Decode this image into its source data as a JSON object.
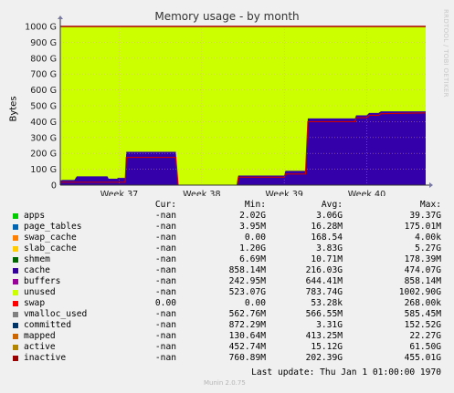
{
  "chart_data": {
    "type": "area",
    "title": "Memory usage - by month",
    "ylabel": "Bytes",
    "ylim": [
      0,
      1000
    ],
    "yticks": [
      "0",
      "100 G",
      "200 G",
      "300 G",
      "400 G",
      "500 G",
      "600 G",
      "700 G",
      "800 G",
      "900 G",
      "1000 G"
    ],
    "xticks": [
      {
        "label": "Week 37",
        "day": 5
      },
      {
        "label": "Week 38",
        "day": 12
      },
      {
        "label": "Week 39",
        "day": 19
      },
      {
        "label": "Week 40",
        "day": 26
      }
    ],
    "x_days": [
      0,
      31
    ],
    "grid": true,
    "series": [
      {
        "name": "cache",
        "color": "#3300aa",
        "points": [
          [
            0,
            30
          ],
          [
            0.1,
            30
          ],
          [
            0.2,
            32
          ],
          [
            1.2,
            32
          ],
          [
            1.4,
            55
          ],
          [
            4.0,
            55
          ],
          [
            4.1,
            40
          ],
          [
            4.8,
            40
          ],
          [
            4.9,
            45
          ],
          [
            5.5,
            45
          ],
          [
            5.6,
            210
          ],
          [
            9.8,
            210
          ],
          [
            10.0,
            0
          ],
          [
            15.0,
            0
          ],
          [
            15.1,
            60
          ],
          [
            18.0,
            60
          ],
          [
            18.1,
            60
          ],
          [
            19.0,
            60
          ],
          [
            19.1,
            90
          ],
          [
            20.8,
            90
          ],
          [
            21.0,
            420
          ],
          [
            25.0,
            420
          ],
          [
            25.1,
            440
          ],
          [
            26.0,
            440
          ],
          [
            26.2,
            455
          ],
          [
            27.0,
            455
          ],
          [
            27.2,
            465
          ],
          [
            31,
            465
          ]
        ]
      },
      {
        "name": "apps",
        "color": "#00cc00",
        "points": [
          [
            0,
            5
          ],
          [
            4,
            5
          ],
          [
            5.5,
            5
          ],
          [
            10,
            0
          ],
          [
            15,
            0
          ],
          [
            15.1,
            4
          ],
          [
            19,
            4
          ],
          [
            21,
            6
          ],
          [
            31,
            6
          ]
        ]
      },
      {
        "name": "unused",
        "color": "#ccff00",
        "points": [
          [
            0,
            1000
          ],
          [
            31,
            1000
          ]
        ]
      }
    ],
    "inactive_line": [
      [
        0,
        18
      ],
      [
        5.5,
        18
      ],
      [
        5.6,
        175
      ],
      [
        9.8,
        175
      ],
      [
        10.0,
        0
      ],
      [
        15.0,
        0
      ],
      [
        15.1,
        50
      ],
      [
        19.0,
        50
      ],
      [
        19.1,
        70
      ],
      [
        20.8,
        70
      ],
      [
        21.0,
        400
      ],
      [
        25.0,
        400
      ],
      [
        25.1,
        425
      ],
      [
        26.0,
        425
      ],
      [
        26.2,
        440
      ],
      [
        27.0,
        440
      ],
      [
        27.2,
        450
      ],
      [
        31,
        455
      ]
    ],
    "swap_line": [
      [
        0,
        1000
      ],
      [
        20.9,
        1000
      ],
      [
        21.0,
        1002
      ],
      [
        31,
        1002
      ]
    ]
  },
  "legend": {
    "headers": {
      "cur": "Cur:",
      "min": "Min:",
      "avg": "Avg:",
      "max": "Max:"
    },
    "rows": [
      {
        "name": "apps",
        "color": "#00cc00",
        "cur": "-nan",
        "min": "2.02G",
        "avg": "3.06G",
        "max": "39.37G"
      },
      {
        "name": "page_tables",
        "color": "#0066b3",
        "cur": "-nan",
        "min": "3.95M",
        "avg": "16.28M",
        "max": "175.01M"
      },
      {
        "name": "swap_cache",
        "color": "#ff8000",
        "cur": "-nan",
        "min": "0.00",
        "avg": "168.54",
        "max": "4.00k"
      },
      {
        "name": "slab_cache",
        "color": "#ffcc00",
        "cur": "-nan",
        "min": "1.20G",
        "avg": "3.83G",
        "max": "5.27G"
      },
      {
        "name": "shmem",
        "color": "#006600",
        "cur": "-nan",
        "min": "6.69M",
        "avg": "10.71M",
        "max": "178.39M"
      },
      {
        "name": "cache",
        "color": "#330099",
        "cur": "-nan",
        "min": "858.14M",
        "avg": "216.03G",
        "max": "474.07G"
      },
      {
        "name": "buffers",
        "color": "#990099",
        "cur": "-nan",
        "min": "242.95M",
        "avg": "644.41M",
        "max": "858.14M"
      },
      {
        "name": "unused",
        "color": "#ccff00",
        "cur": "-nan",
        "min": "523.07G",
        "avg": "783.74G",
        "max": "1002.90G"
      },
      {
        "name": "swap",
        "color": "#ff0000",
        "cur": "0.00",
        "min": "0.00",
        "avg": "53.28k",
        "max": "268.00k"
      },
      {
        "name": "vmalloc_used",
        "color": "#808080",
        "cur": "-nan",
        "min": "562.76M",
        "avg": "566.55M",
        "max": "585.45M"
      },
      {
        "name": "committed",
        "color": "#003366",
        "cur": "-nan",
        "min": "872.29M",
        "avg": "3.31G",
        "max": "152.52G"
      },
      {
        "name": "mapped",
        "color": "#cc6600",
        "cur": "-nan",
        "min": "130.64M",
        "avg": "413.25M",
        "max": "22.27G"
      },
      {
        "name": "active",
        "color": "#b38600",
        "cur": "-nan",
        "min": "452.74M",
        "avg": "15.12G",
        "max": "61.50G"
      },
      {
        "name": "inactive",
        "color": "#990000",
        "cur": "-nan",
        "min": "760.89M",
        "avg": "202.39G",
        "max": "455.01G"
      }
    ]
  },
  "footer": {
    "last_update": "Last update: Thu Jan  1 01:00:00 1970",
    "version": "Munin 2.0.75",
    "side_label": "RRDTOOL / TOBI OETIKER"
  }
}
